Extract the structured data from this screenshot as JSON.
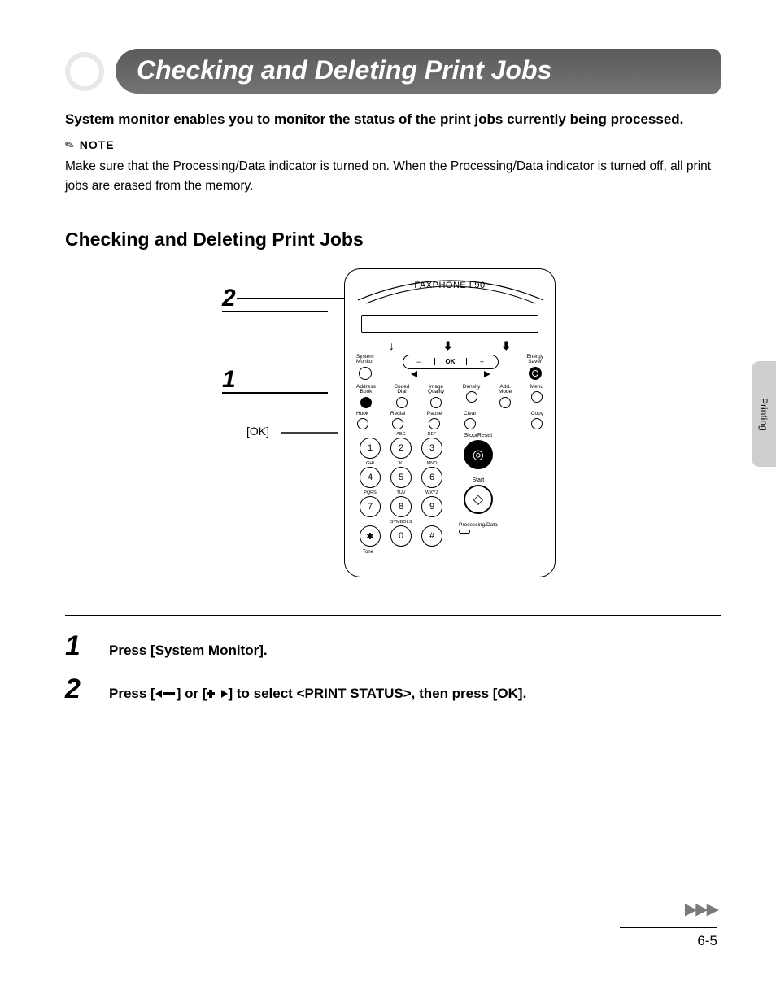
{
  "title": "Checking and Deleting Print Jobs",
  "intro": "System monitor enables you to monitor the status of the print jobs currently being processed.",
  "note": {
    "label": "NOTE",
    "text": "Make sure that the Processing/Data indicator is turned on. When the Processing/Data indicator is turned off, all print jobs are erased from the memory."
  },
  "section_heading": "Checking and Deleting Print Jobs",
  "device": {
    "brand": "FAXPHONE L90",
    "callouts": {
      "one": "1",
      "two": "2",
      "ok": "[OK]"
    },
    "nav": {
      "minus": "−",
      "ok": "OK",
      "plus": "+"
    },
    "top_buttons": {
      "system_monitor": "System\nMonitor",
      "energy_saver": "Energy\nSaver"
    },
    "row2": {
      "address_book": "Address\nBook",
      "coded_dial": "Coded\nDial",
      "image_quality": "Image\nQuality",
      "density": "Density",
      "add_mode": "Add.\nMode",
      "menu": "Menu"
    },
    "row3": {
      "hook": "Hook",
      "redial": "Redial",
      "pause": "Pause",
      "clear": "Clear",
      "copy": "Copy"
    },
    "keypad": {
      "1": "1",
      "2": "2",
      "3": "3",
      "4": "4",
      "5": "5",
      "6": "6",
      "7": "7",
      "8": "8",
      "9": "9",
      "star": "✱",
      "0": "0",
      "hash": "#",
      "sup": {
        "2": "ABC",
        "3": "DEF",
        "4": "GHI",
        "5": "JKL",
        "6": "MNO",
        "7": "PQRS",
        "8": "TUV",
        "9": "WXYZ",
        "0": "SYMBOLS"
      },
      "tone": "Tone"
    },
    "right": {
      "stop_reset": "Stop/Reset",
      "start": "Start",
      "processing": "Processing/Data"
    }
  },
  "steps": {
    "s1": {
      "num": "1",
      "text": "Press [System Monitor]."
    },
    "s2": {
      "num": "2",
      "pre": "Press [",
      "mid": "] or [",
      "post": "] to select <PRINT STATUS>, then press [OK]."
    }
  },
  "side_tab": "Printing",
  "footer": {
    "page": "6-5"
  }
}
